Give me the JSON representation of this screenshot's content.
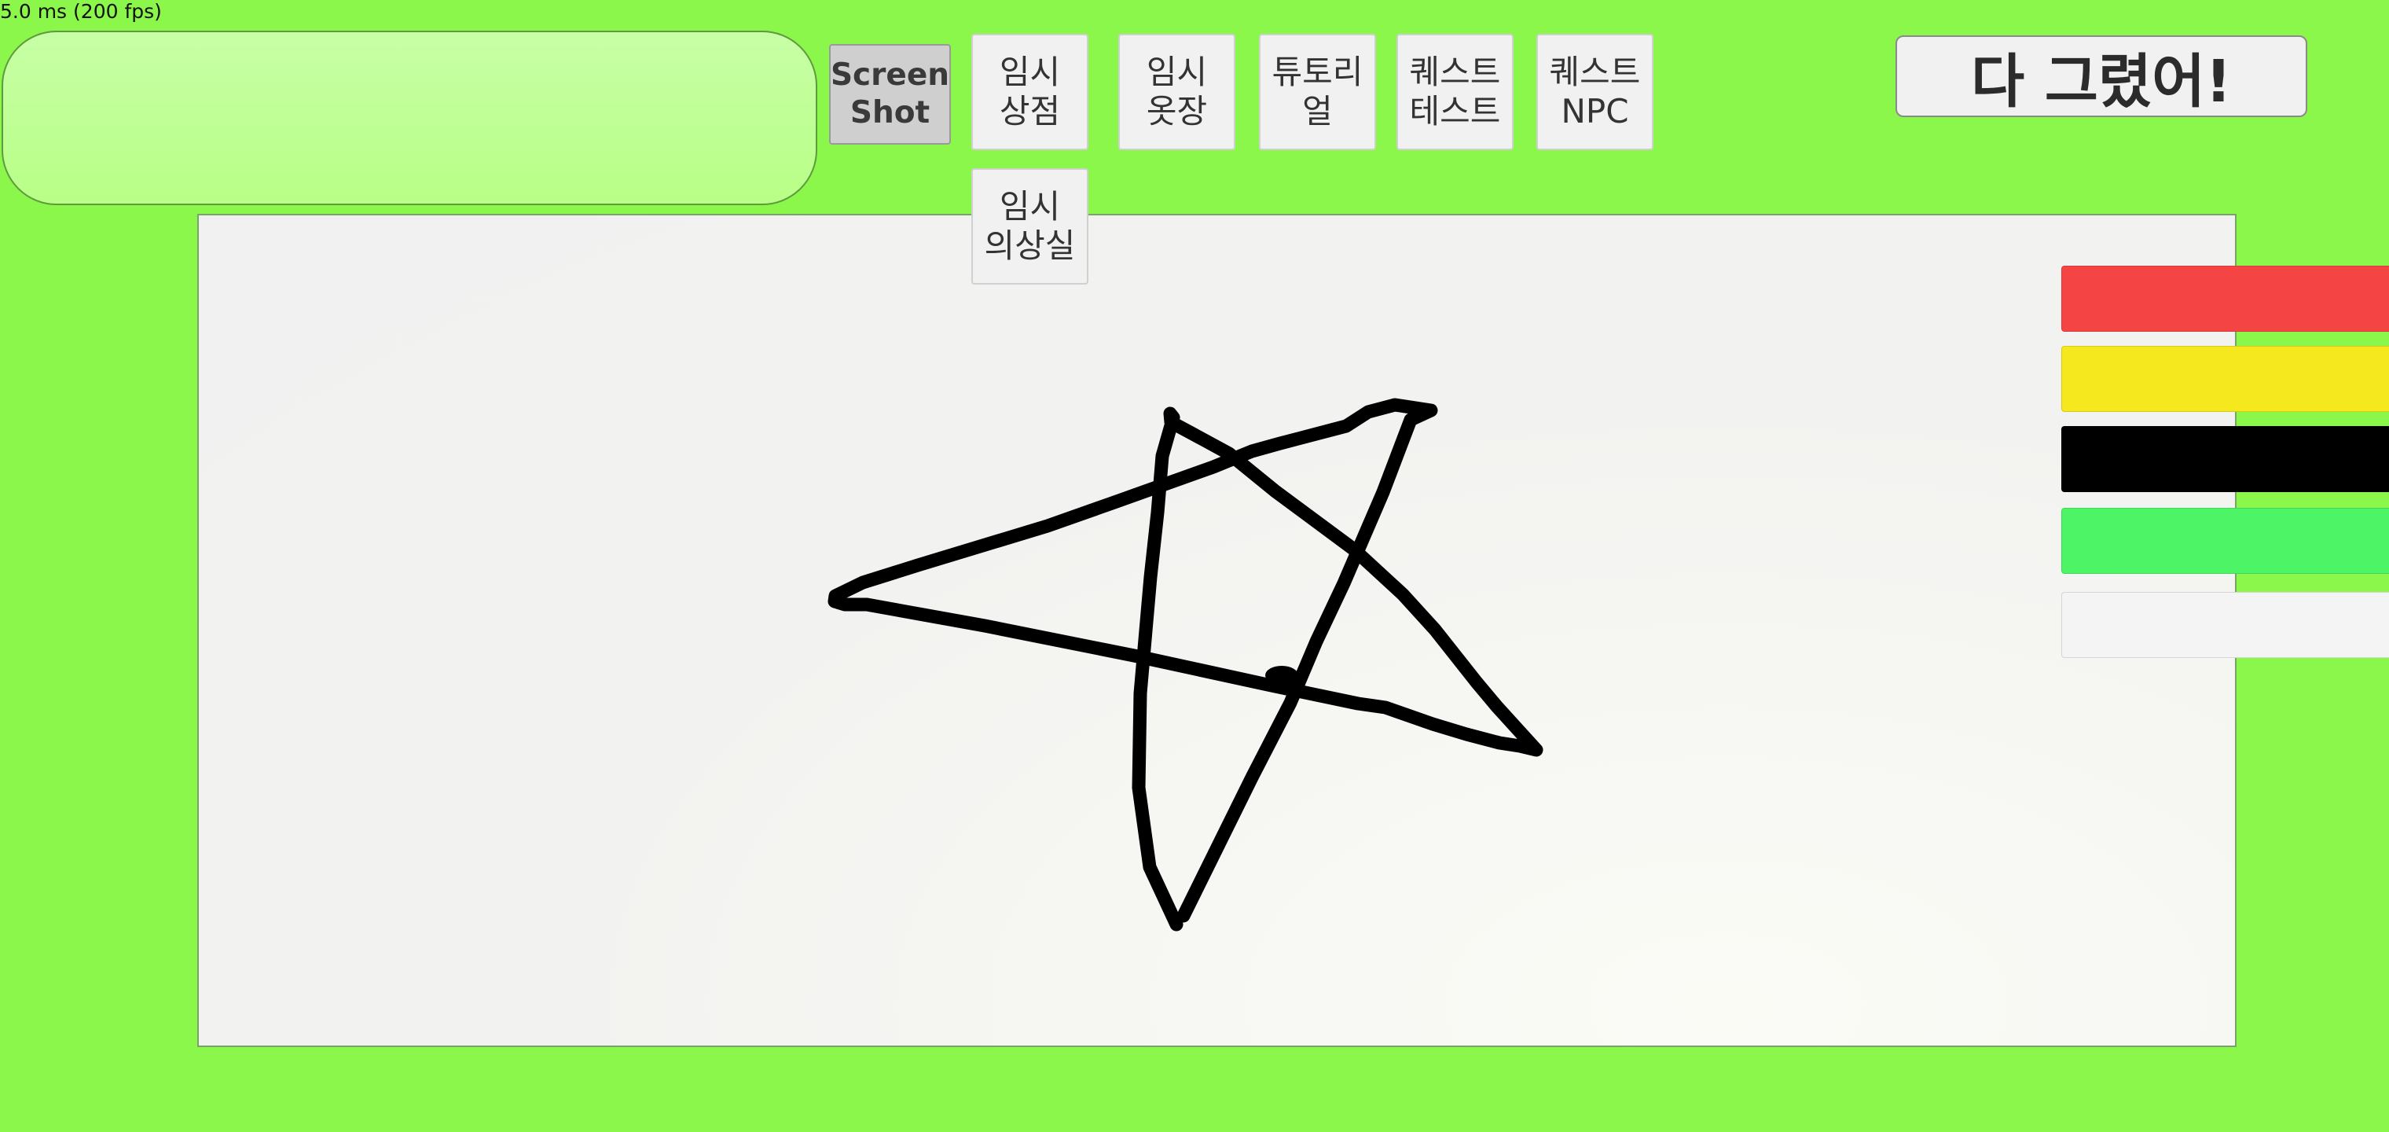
{
  "status": {
    "fps_text": "5.0 ms (200 fps)"
  },
  "toolbar": {
    "screenshot_label": "Screen\nShot",
    "temp_shop_label": "임시\n상점",
    "temp_closet_label": "임시\n옷장",
    "tutorial_label": "튜토리\n얼",
    "quest_test_label": "퀘스트\n테스트",
    "quest_npc_label": "퀘스트\nNPC",
    "temp_dressing_room_label": "임시\n의상실",
    "done_label": "다 그렸어!"
  },
  "palette": {
    "colors": [
      {
        "name": "red",
        "hex": "#f54444"
      },
      {
        "name": "yellow",
        "hex": "#f5e81e"
      },
      {
        "name": "black",
        "hex": "#000000"
      },
      {
        "name": "green",
        "hex": "#4df566"
      },
      {
        "name": "white",
        "hex": "#f4f4f4"
      }
    ]
  },
  "drawing": {
    "stroke_color": "#000000",
    "shape": "star"
  },
  "theme": {
    "background": "#8cf74b",
    "chat_panel": "#b8ff86",
    "canvas": "#f2f2f0"
  }
}
